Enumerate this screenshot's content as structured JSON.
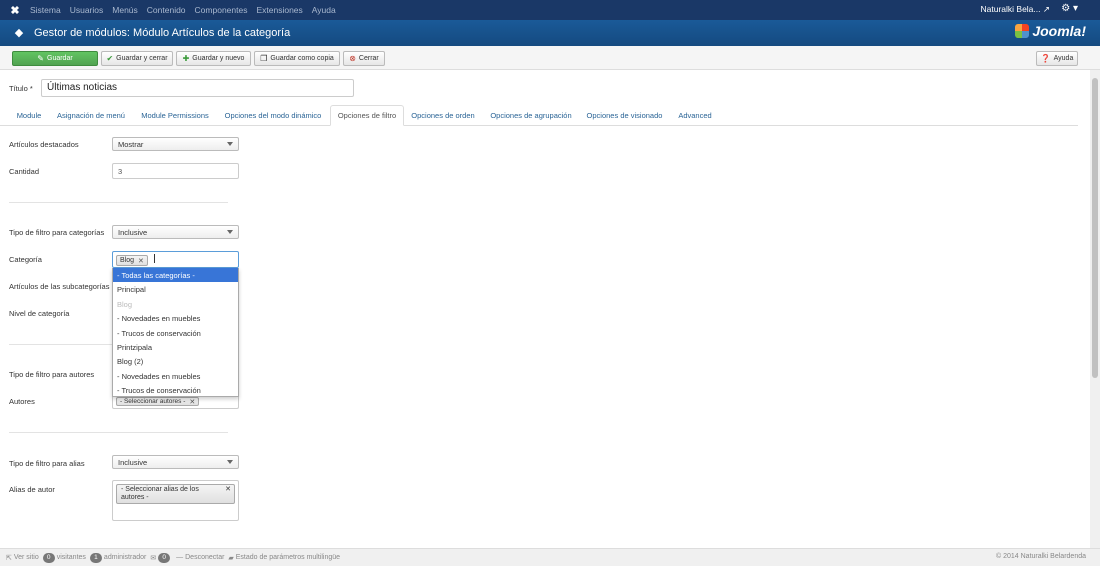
{
  "topnav": {
    "menu": [
      "Sistema",
      "Usuarios",
      "Menús",
      "Contenido",
      "Componentes",
      "Extensiones",
      "Ayuda"
    ],
    "user": "Naturalki Bela..."
  },
  "header": {
    "title": "Gestor de módulos: Módulo Artículos de la categoría",
    "brand": "Joomla!"
  },
  "toolbar": {
    "save": "Guardar",
    "save_close": "Guardar y cerrar",
    "save_new": "Guardar y nuevo",
    "save_copy": "Guardar como copia",
    "close": "Cerrar",
    "help": "Ayuda"
  },
  "title_field": {
    "label": "Título *",
    "value": "Últimas noticias"
  },
  "tabs": [
    "Module",
    "Asignación de menú",
    "Module Permissions",
    "Opciones del modo dinámico",
    "Opciones de filtro",
    "Opciones de orden",
    "Opciones de agrupación",
    "Opciones de visionado",
    "Advanced"
  ],
  "fields": {
    "featured_label": "Artículos destacados",
    "featured_value": "Mostrar",
    "count_label": "Cantidad",
    "count_value": "3",
    "cat_filter_label": "Tipo de filtro para categorías",
    "cat_filter_value": "Inclusive",
    "category_label": "Categoría",
    "category_tag": "Blog",
    "subcat_label": "Artículos de las subcategorías",
    "level_label": "Nivel de categoría",
    "author_filter_label": "Tipo de filtro para autores",
    "authors_label": "Autores",
    "authors_placeholder": "- Seleccionar autores -",
    "alias_filter_label": "Tipo de filtro para alias",
    "alias_filter_value": "Inclusive",
    "alias_label": "Alias de autor",
    "alias_placeholder": "- Seleccionar alias de los autores -"
  },
  "dropdown": [
    "- Todas las categorías -",
    "Principal",
    "Blog",
    "- Novedades en muebles",
    "- Trucos de conservación",
    "Printzipala",
    "Blog (2)",
    "- Novedades en muebles",
    "- Trucos de conservación"
  ],
  "statusbar": {
    "view_site": "Ver sitio",
    "visitors_count": "0",
    "visitors": "visitantes",
    "admins_count": "1",
    "admins": "administrador",
    "messages_count": "0",
    "logout": "Desconectar",
    "multilang": "Estado de parámetros multilingüe",
    "copyright": "© 2014 Naturalki Belardenda"
  }
}
